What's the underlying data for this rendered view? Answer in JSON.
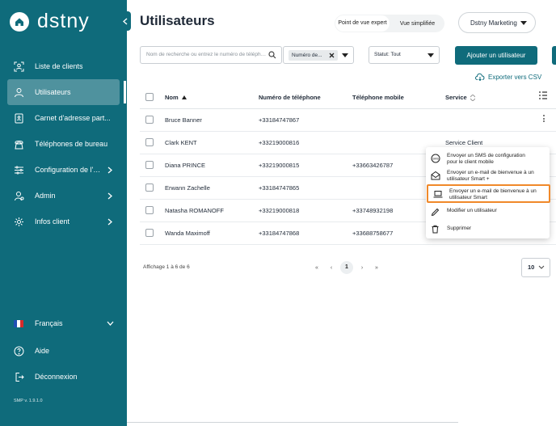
{
  "brand": {
    "name": "dstny"
  },
  "nav": {
    "items": [
      {
        "label": "Liste de clients",
        "icon": "users-scan-icon",
        "chevron": false
      },
      {
        "label": "Utilisateurs",
        "icon": "user-icon",
        "chevron": false,
        "active": true
      },
      {
        "label": "Carnet d'adresse part...",
        "icon": "address-book-icon",
        "chevron": false
      },
      {
        "label": "Téléphones de bureau",
        "icon": "desk-phone-icon",
        "chevron": false
      },
      {
        "label": "Configuration de l'org...",
        "icon": "sliders-icon",
        "chevron": true
      },
      {
        "label": "Admin",
        "icon": "admin-user-icon",
        "chevron": true
      },
      {
        "label": "Infos client",
        "icon": "gear-icon",
        "chevron": true
      }
    ],
    "language": "Français",
    "help": "Aide",
    "logout": "Déconnexion",
    "version": "SMP v. 1.9.1.0"
  },
  "header": {
    "title": "Utilisateurs",
    "view_expert": "Point de vue expert",
    "view_simple": "Vue simplifiée",
    "account": "Dstny Marketing"
  },
  "toolbar": {
    "search_placeholder": "Nom de recherche ou entrez le numéro de téléphone",
    "filter_chip": "Numéro de...",
    "status": "Statut: Tout",
    "add_button": "Ajouter un utilisateur",
    "export": "Exporter vers CSV"
  },
  "table": {
    "headers": {
      "name": "Nom",
      "phone": "Numéro de téléphone",
      "mobile": "Téléphone mobile",
      "service": "Service"
    },
    "rows": [
      {
        "name": "Bruce Banner",
        "phone": "+33184747867",
        "mobile": "",
        "service": ""
      },
      {
        "name": "Clark KENT",
        "phone": "+33219000816",
        "mobile": "",
        "service": "Service Client"
      },
      {
        "name": "Diana PRINCE",
        "phone": "+33219000815",
        "mobile": "+33663426787",
        "service": ""
      },
      {
        "name": "Erwann Zachelle",
        "phone": "+33184747865",
        "mobile": "",
        "service": ""
      },
      {
        "name": "Natasha ROMANOFF",
        "phone": "+33219000818",
        "mobile": "+33748932198",
        "service": ""
      },
      {
        "name": "Wanda Maximoff",
        "phone": "+33184747868",
        "mobile": "+33688758677",
        "service": ""
      }
    ]
  },
  "context_menu": {
    "items": [
      {
        "label1": "Envoyer un SMS de configuration",
        "label2": "pour le client mobile",
        "icon": "sms-icon"
      },
      {
        "label1": "Envoyer un e-mail de bienvenue à un",
        "label2": "utilisateur Smart +",
        "icon": "mail-open-icon"
      },
      {
        "label1": "Envoyer un e-mail de bienvenue à un",
        "label2": "utilisateur Smart",
        "icon": "laptop-icon",
        "highlighted": true
      },
      {
        "label1": "Modifier un utilisateur",
        "label2": "",
        "icon": "pencil-icon"
      },
      {
        "label1": "Supprimer",
        "label2": "",
        "icon": "trash-icon"
      }
    ]
  },
  "footer": {
    "info": "Affichage 1 à 6 de 6",
    "first": "«",
    "prev": "‹",
    "page": "1",
    "next": "›",
    "last": "»",
    "per_page": "10"
  },
  "colors": {
    "primary": "#0f6b7b",
    "active_nav": "#4f929e",
    "highlight": "#f0892a"
  }
}
